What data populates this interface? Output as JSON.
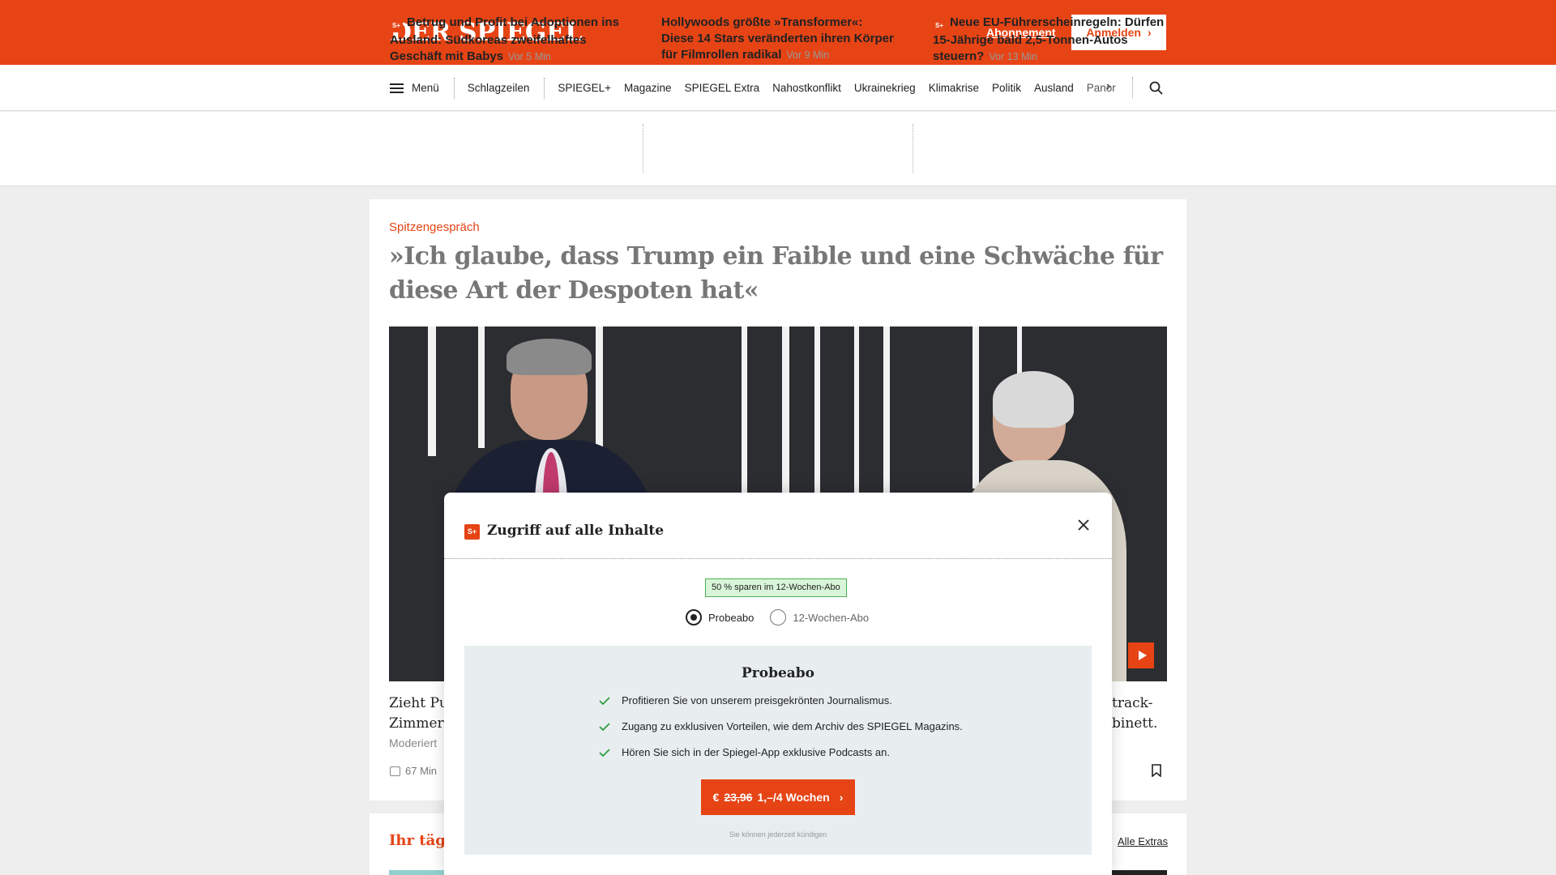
{
  "header": {
    "logo": "DER SPIEGEL",
    "abo_link": "Abonnement",
    "login_button": "Anmelden",
    "brand_color": "#e64415"
  },
  "nav": {
    "menu_label": "Menü",
    "items": [
      "Schlagzeilen",
      "SPIEGEL+",
      "Magazine",
      "SPIEGEL Extra",
      "Nahostkonflikt",
      "Ukrainekrieg",
      "Klimakrise",
      "Politik",
      "Ausland",
      "Panor"
    ]
  },
  "ticker": [
    {
      "badge": "S+",
      "title": "Betrug und Profit bei Adoptionen ins Ausland: Südkoreas zweifelhaftes Geschäft mit Babys",
      "time": "Vor 5 Min"
    },
    {
      "badge": "",
      "title": "Hollywoods größte »Transformer«: Diese 14 Stars veränderten ihren Körper für Filmrollen radikal",
      "time": "Vor 9 Min"
    },
    {
      "badge": "S+",
      "title": "Neue EU-Führerscheinregeln: Dürfen 15-Jährige bald 2,5-Tonnen-Autos steuern?",
      "time": "Vor 13 Min"
    }
  ],
  "article": {
    "kicker": "Spitzengespräch",
    "headline": "»Ich glaube, dass Trump ein Faible und eine Schwäche für diese Art der Despoten hat«",
    "teaser_left_line1": "Zieht Pu",
    "teaser_left_line2": "Zimmerr",
    "moderator_prefix": "Moderiert",
    "duration": "67 Min",
    "teaser_right_line1": "track-",
    "teaser_right_line2": "binett."
  },
  "second_card": {
    "title": "Ihr täglic",
    "link": "Alle Extras"
  },
  "modal": {
    "badge": "S+",
    "title": "Zugriff auf alle Inhalte",
    "save_badge": "50 % sparen im 12-Wochen-Abo",
    "options": [
      {
        "label": "Probeabo",
        "selected": true
      },
      {
        "label": "12-Wochen-Abo",
        "selected": false
      }
    ],
    "plan": {
      "title": "Probeabo",
      "features": [
        "Profitieren Sie von unserem preisgekrönten Journalismus.",
        "Zugang zu exklusiven Vorteilen, wie dem Archiv des SPIEGEL Magazins.",
        "Hören Sie sich in der Spiegel-App exklusive Podcasts an."
      ],
      "cta_currency": "€",
      "cta_old_price": "23,96",
      "cta_new_price": "1,–/4 Wochen",
      "cancel_note": "Sie können jederzeit kündigen"
    }
  }
}
